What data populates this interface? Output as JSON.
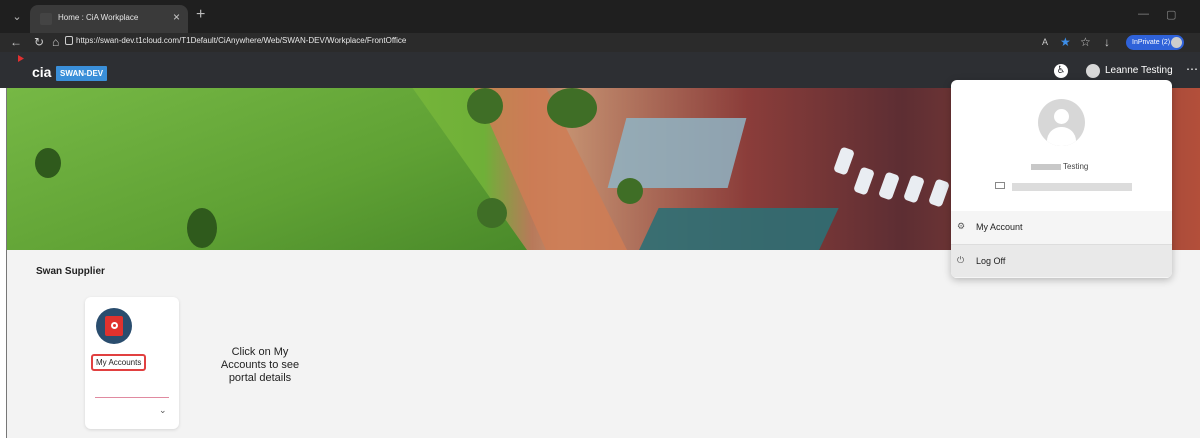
{
  "browser": {
    "tab_title": "Home : CiA Workplace",
    "url": "https://swan-dev.t1cloud.com/T1Default/CiAnywhere/Web/SWAN-DEV/Workplace/FrontOffice",
    "inprivate_label": "InPrivate (2)"
  },
  "app": {
    "logo_text": "cia",
    "environment": "SWAN-DEV",
    "user_name": "Leanne Testing"
  },
  "content": {
    "section_title": "Swan Supplier",
    "tile_label": "My Accounts",
    "annotation": "Click on My Accounts to see portal details"
  },
  "profile_popup": {
    "name_suffix": "Testing",
    "menu": [
      {
        "label": "My Account",
        "icon": "user-settings-icon"
      },
      {
        "label": "Log Off",
        "icon": "power-icon"
      }
    ]
  },
  "colors": {
    "header_bg": "#2d2f33",
    "env_badge": "#3a8fd9",
    "tile_icon_bg": "#2a4d6e",
    "tile_icon_fg": "#e0322e",
    "highlight_border": "#e14040",
    "inprivate": "#2f62d9"
  }
}
